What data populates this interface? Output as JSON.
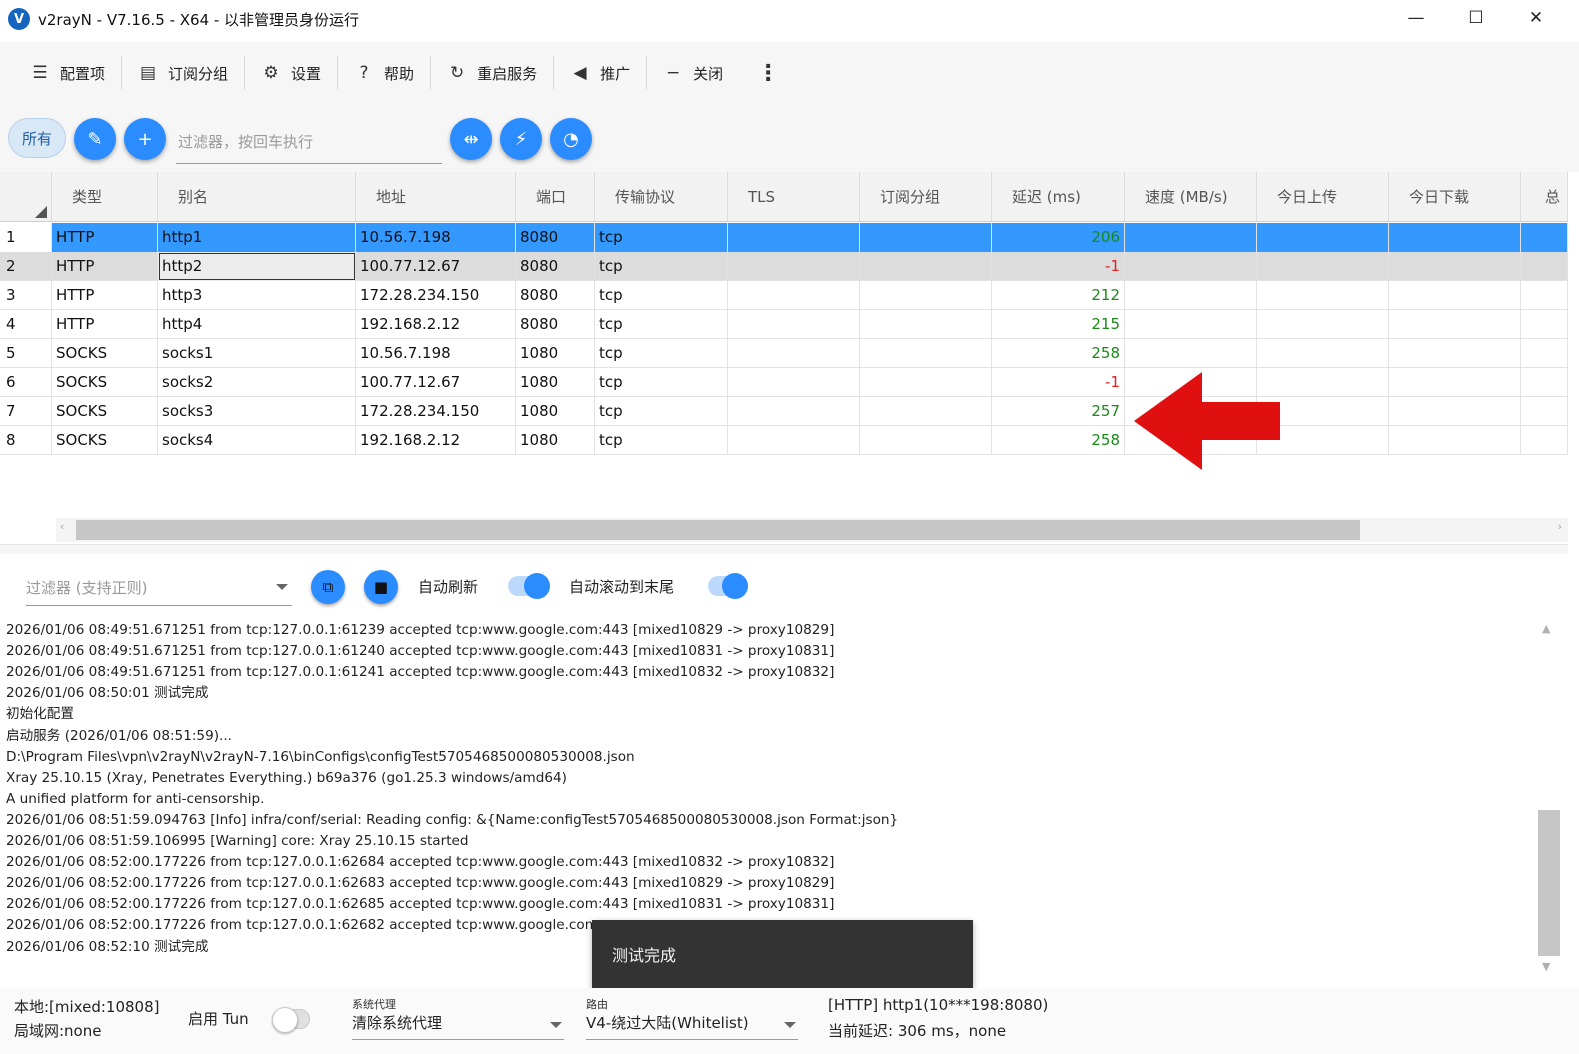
{
  "window": {
    "title": "v2rayN - V7.16.5 - X64 - 以非管理员身份运行",
    "logo_letter": "V",
    "minimize": "—",
    "maximize": "☐",
    "close": "✕"
  },
  "toolbar": {
    "items": [
      {
        "label": "配置项",
        "icon": "menu-icon"
      },
      {
        "label": "订阅分组",
        "icon": "subscription-icon"
      },
      {
        "label": "设置",
        "icon": "gear-icon"
      },
      {
        "label": "帮助",
        "icon": "help-icon"
      },
      {
        "label": "重启服务",
        "icon": "restart-icon"
      },
      {
        "label": "推广",
        "icon": "speaker-icon"
      },
      {
        "label": "关闭",
        "icon": "minus-icon"
      }
    ],
    "more": "⋮"
  },
  "filter": {
    "all_label": "所有",
    "placeholder": "过滤器，按回车执行"
  },
  "grid": {
    "columns": [
      "类型",
      "别名",
      "地址",
      "端口",
      "传输协议",
      "TLS",
      "订阅分组",
      "延迟 (ms)",
      "速度 (MB/s)",
      "今日上传",
      "今日下载",
      "总"
    ],
    "rows": [
      {
        "num": "1",
        "type": "HTTP",
        "alias": "http1",
        "address": "10.56.7.198",
        "port": "8080",
        "transport": "tcp",
        "delay": "206"
      },
      {
        "num": "2",
        "type": "HTTP",
        "alias": "http2",
        "address": "100.77.12.67",
        "port": "8080",
        "transport": "tcp",
        "delay": "-1"
      },
      {
        "num": "3",
        "type": "HTTP",
        "alias": "http3",
        "address": "172.28.234.150",
        "port": "8080",
        "transport": "tcp",
        "delay": "212"
      },
      {
        "num": "4",
        "type": "HTTP",
        "alias": "http4",
        "address": "192.168.2.12",
        "port": "8080",
        "transport": "tcp",
        "delay": "215"
      },
      {
        "num": "5",
        "type": "SOCKS",
        "alias": "socks1",
        "address": "10.56.7.198",
        "port": "1080",
        "transport": "tcp",
        "delay": "258"
      },
      {
        "num": "6",
        "type": "SOCKS",
        "alias": "socks2",
        "address": "100.77.12.67",
        "port": "1080",
        "transport": "tcp",
        "delay": "-1"
      },
      {
        "num": "7",
        "type": "SOCKS",
        "alias": "socks3",
        "address": "172.28.234.150",
        "port": "1080",
        "transport": "tcp",
        "delay": "257"
      },
      {
        "num": "8",
        "type": "SOCKS",
        "alias": "socks4",
        "address": "192.168.2.12",
        "port": "1080",
        "transport": "tcp",
        "delay": "258"
      }
    ],
    "colors": {
      "delay_ok": "#1a8a1a",
      "delay_fail": "#e02020",
      "selected": "#3399ff"
    }
  },
  "log_controls": {
    "filter_placeholder": "过滤器 (支持正则)",
    "auto_refresh_label": "自动刷新",
    "auto_scroll_label": "自动滚动到末尾",
    "auto_refresh_on": true,
    "auto_scroll_on": true
  },
  "log": {
    "lines": [
      "2026/01/06 08:49:51.671251 from tcp:127.0.0.1:61239 accepted tcp:www.google.com:443 [mixed10829 -> proxy10829]",
      "2026/01/06 08:49:51.671251 from tcp:127.0.0.1:61240 accepted tcp:www.google.com:443 [mixed10831 -> proxy10831]",
      "2026/01/06 08:49:51.671251 from tcp:127.0.0.1:61241 accepted tcp:www.google.com:443 [mixed10832 -> proxy10832]",
      "2026/01/06 08:50:01 测试完成",
      "初始化配置",
      "启动服务 (2026/01/06 08:51:59)...",
      "D:\\Program Files\\vpn\\v2rayN\\v2rayN-7.16\\binConfigs\\configTest5705468500080530008.json",
      "Xray 25.10.15 (Xray, Penetrates Everything.) b69a376 (go1.25.3 windows/amd64)",
      "A unified platform for anti-censorship.",
      "2026/01/06 08:51:59.094763 [Info] infra/conf/serial: Reading config: &{Name:configTest5705468500080530008.json Format:json}",
      "2026/01/06 08:51:59.106995 [Warning] core: Xray 25.10.15 started",
      "2026/01/06 08:52:00.177226 from tcp:127.0.0.1:62684 accepted tcp:www.google.com:443 [mixed10832 -> proxy10832]",
      "2026/01/06 08:52:00.177226 from tcp:127.0.0.1:62683 accepted tcp:www.google.com:443 [mixed10829 -> proxy10829]",
      "2026/01/06 08:52:00.177226 from tcp:127.0.0.1:62685 accepted tcp:www.google.com:443 [mixed10831 -> proxy10831]",
      "2026/01/06 08:52:00.177226 from tcp:127.0.0.1:62682 accepted tcp:www.google.com:",
      "2026/01/06 08:52:10 测试完成"
    ]
  },
  "toast": {
    "text": "测试完成"
  },
  "status": {
    "local": "本地:[mixed:10808]",
    "lan": "局域网:none",
    "tun_label": "启用 Tun",
    "tun_on": false,
    "sysproxy_caption": "系统代理",
    "sysproxy_value": "清除系统代理",
    "route_caption": "路由",
    "route_value": "V4-绕过大陆(Whitelist)",
    "current_server": "[HTTP] http1(10***198:8080)",
    "current_delay": "当前延迟: 306 ms，none"
  }
}
